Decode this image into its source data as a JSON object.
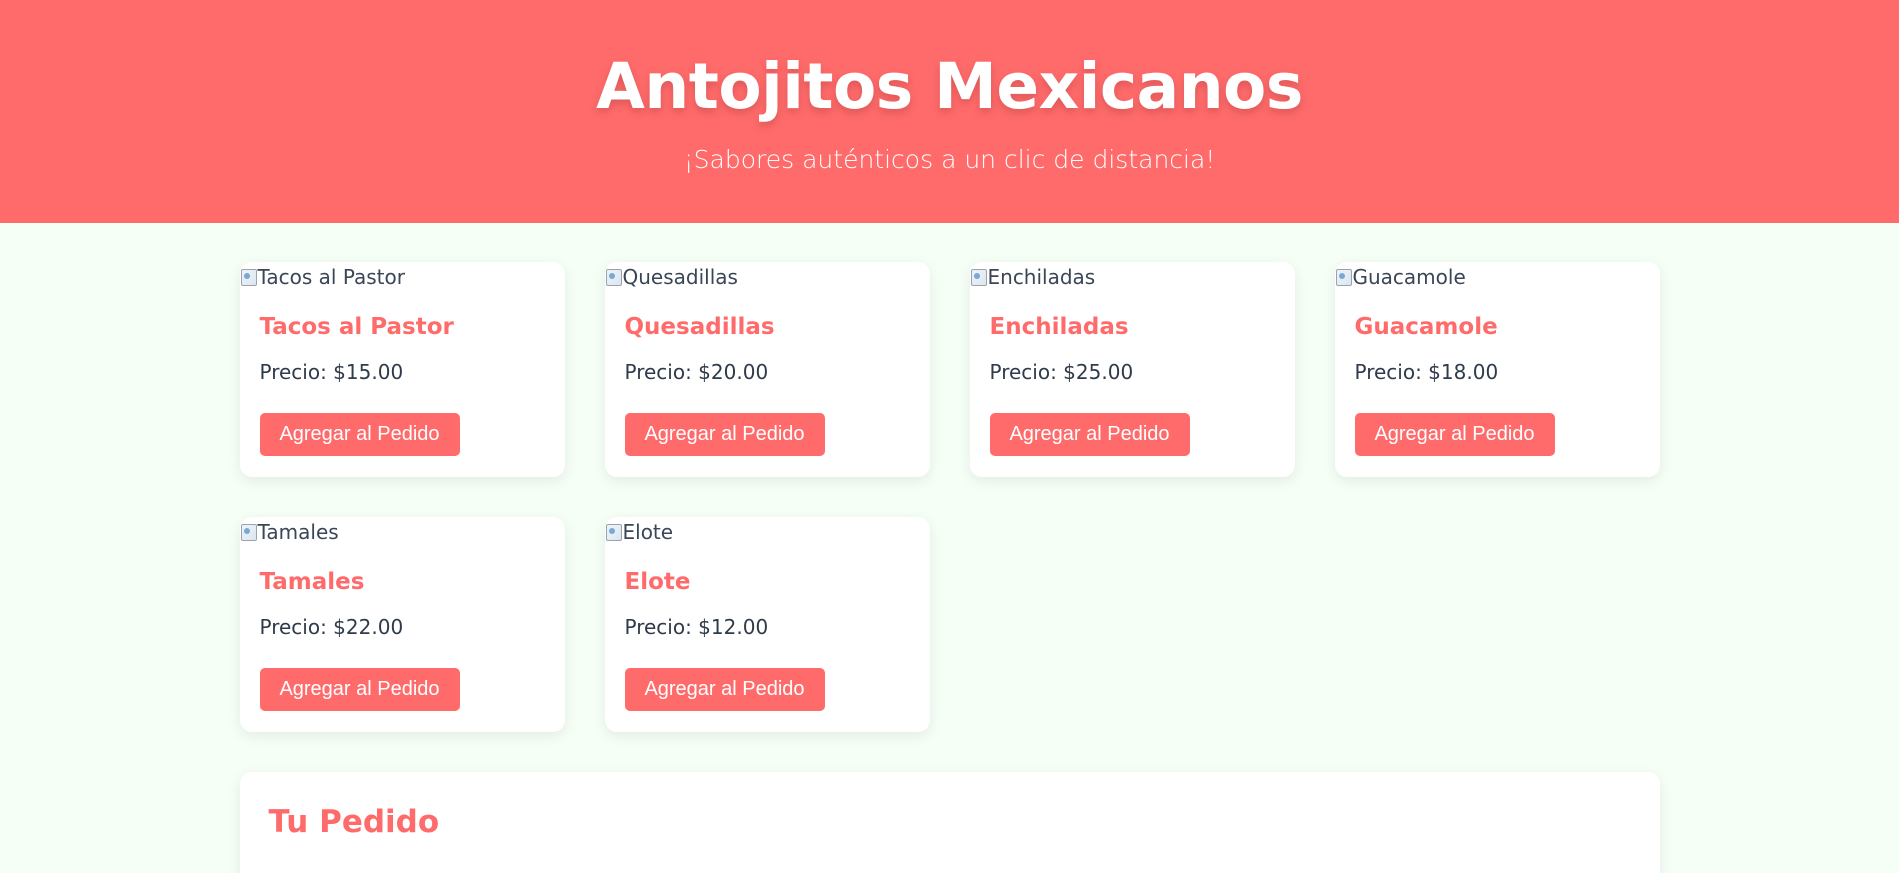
{
  "header": {
    "title": "Antojitos Mexicanos",
    "subtitle": "¡Sabores auténticos a un clic de distancia!"
  },
  "products": [
    {
      "image_alt": "Tacos al Pastor",
      "name": "Tacos al Pastor",
      "price": "Precio: $15.00",
      "button": "Agregar al Pedido"
    },
    {
      "image_alt": "Quesadillas",
      "name": "Quesadillas",
      "price": "Precio: $20.00",
      "button": "Agregar al Pedido"
    },
    {
      "image_alt": "Enchiladas",
      "name": "Enchiladas",
      "price": "Precio: $25.00",
      "button": "Agregar al Pedido"
    },
    {
      "image_alt": "Guacamole",
      "name": "Guacamole",
      "price": "Precio: $18.00",
      "button": "Agregar al Pedido"
    },
    {
      "image_alt": "Tamales",
      "name": "Tamales",
      "price": "Precio: $22.00",
      "button": "Agregar al Pedido"
    },
    {
      "image_alt": "Elote",
      "name": "Elote",
      "price": "Precio: $12.00",
      "button": "Agregar al Pedido"
    }
  ],
  "order": {
    "title": "Tu Pedido"
  },
  "colors": {
    "accent": "#ff6b6b",
    "background": "#f5fff6",
    "card": "#ffffff",
    "text": "#2f3b4a"
  }
}
